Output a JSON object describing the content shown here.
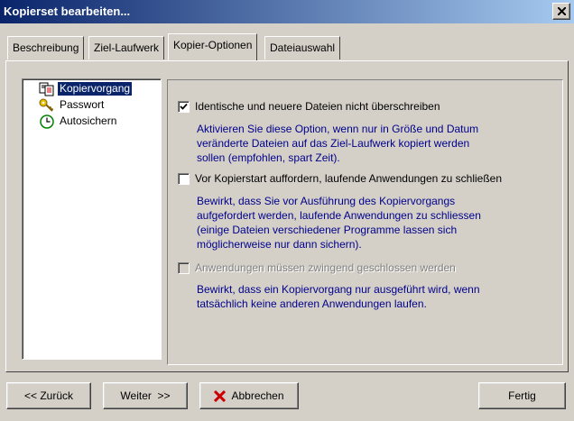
{
  "window": {
    "title": "Kopierset bearbeiten..."
  },
  "tabs": [
    {
      "label": "Beschreibung",
      "active": false
    },
    {
      "label": "Ziel-Laufwerk",
      "active": false
    },
    {
      "label": "Kopier-Optionen",
      "active": true
    },
    {
      "label": "Dateiauswahl",
      "active": false
    }
  ],
  "tree": [
    {
      "label": "Kopiervorgang",
      "icon": "document-copy-icon",
      "selected": true
    },
    {
      "label": "Passwort",
      "icon": "key-icon",
      "selected": false
    },
    {
      "label": "Autosichern",
      "icon": "clock-icon",
      "selected": false
    }
  ],
  "options": [
    {
      "label": "Identische und neuere Dateien nicht überschreiben",
      "checked": true,
      "enabled": true,
      "description": "Aktivieren Sie diese Option, wenn nur in Größe und Datum\nveränderte Dateien auf das Ziel-Laufwerk kopiert werden\nsollen (empfohlen, spart Zeit)."
    },
    {
      "label": "Vor Kopierstart auffordern, laufende Anwendungen zu schließen",
      "checked": false,
      "enabled": true,
      "description": "Bewirkt, dass Sie vor Ausführung des Kopiervorgangs\naufgefordert werden, laufende Anwendungen zu schliessen\n(einige Dateien verschiedener Programme lassen sich\nmöglicherweise nur dann sichern)."
    },
    {
      "label": "Anwendungen müssen zwingend geschlossen werden",
      "checked": false,
      "enabled": false,
      "description": "Bewirkt, dass ein Kopiervorgang nur ausgeführt wird, wenn\ntatsächlich keine anderen Anwendungen laufen."
    }
  ],
  "buttons": {
    "back": "<< Zurück",
    "next": "Weiter  >>",
    "cancel": "Abbrechen",
    "finish": "Fertig"
  },
  "colors": {
    "title_start": "#0a246a",
    "title_end": "#a6caf0",
    "description_text": "#00008b",
    "cancel_icon": "#cc0000"
  }
}
